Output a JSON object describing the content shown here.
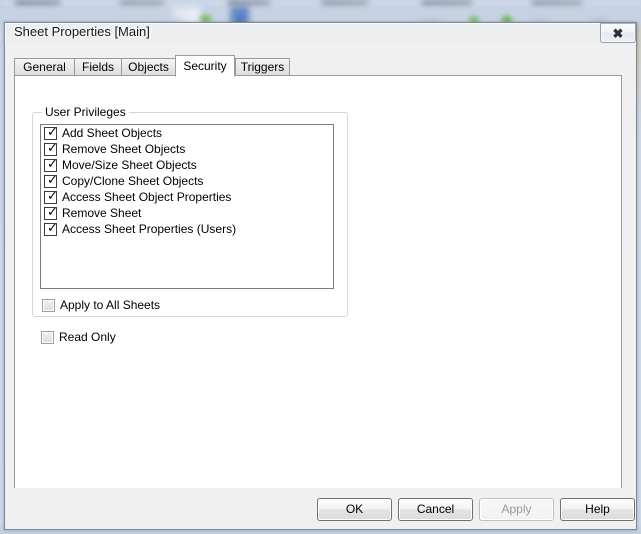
{
  "window": {
    "title": "Sheet Properties [Main]",
    "close_button": {
      "icon": "close-icon",
      "glyph": "✖",
      "tooltip": "Close"
    }
  },
  "tabs": {
    "items": [
      {
        "label": "General",
        "active": false
      },
      {
        "label": "Fields",
        "active": false
      },
      {
        "label": "Objects",
        "active": false
      },
      {
        "label": "Security",
        "active": true
      },
      {
        "label": "Triggers",
        "active": false
      }
    ],
    "selected": "Security"
  },
  "security_page": {
    "group": {
      "label": "User Privileges",
      "privileges": [
        {
          "label": "Add Sheet Objects",
          "checked": true
        },
        {
          "label": "Remove Sheet Objects",
          "checked": true
        },
        {
          "label": "Move/Size Sheet Objects",
          "checked": true
        },
        {
          "label": "Copy/Clone Sheet Objects",
          "checked": true
        },
        {
          "label": "Access Sheet Object Properties",
          "checked": true
        },
        {
          "label": "Remove Sheet",
          "checked": true
        },
        {
          "label": "Access Sheet Properties (Users)",
          "checked": true
        }
      ],
      "apply_to_all_sheets": {
        "label": "Apply to All Sheets",
        "checked": false,
        "enabled": false
      }
    },
    "read_only": {
      "label": "Read Only",
      "checked": false,
      "enabled": false
    }
  },
  "footer": {
    "buttons": [
      {
        "label": "OK",
        "enabled": true
      },
      {
        "label": "Cancel",
        "enabled": true
      },
      {
        "label": "Apply",
        "enabled": false
      },
      {
        "label": "Help",
        "enabled": true
      }
    ]
  },
  "colors": {
    "dialog_face": "#f0f0f0",
    "page_white": "#ffffff",
    "frame_border": "#7d8895",
    "tab_border": "#9a9a9a",
    "listbox_border": "#7b7b7b",
    "group_border": "#d6d6d6",
    "disabled_text": "#9a9a9a",
    "glass_backdrop": "#c7d3e4"
  }
}
